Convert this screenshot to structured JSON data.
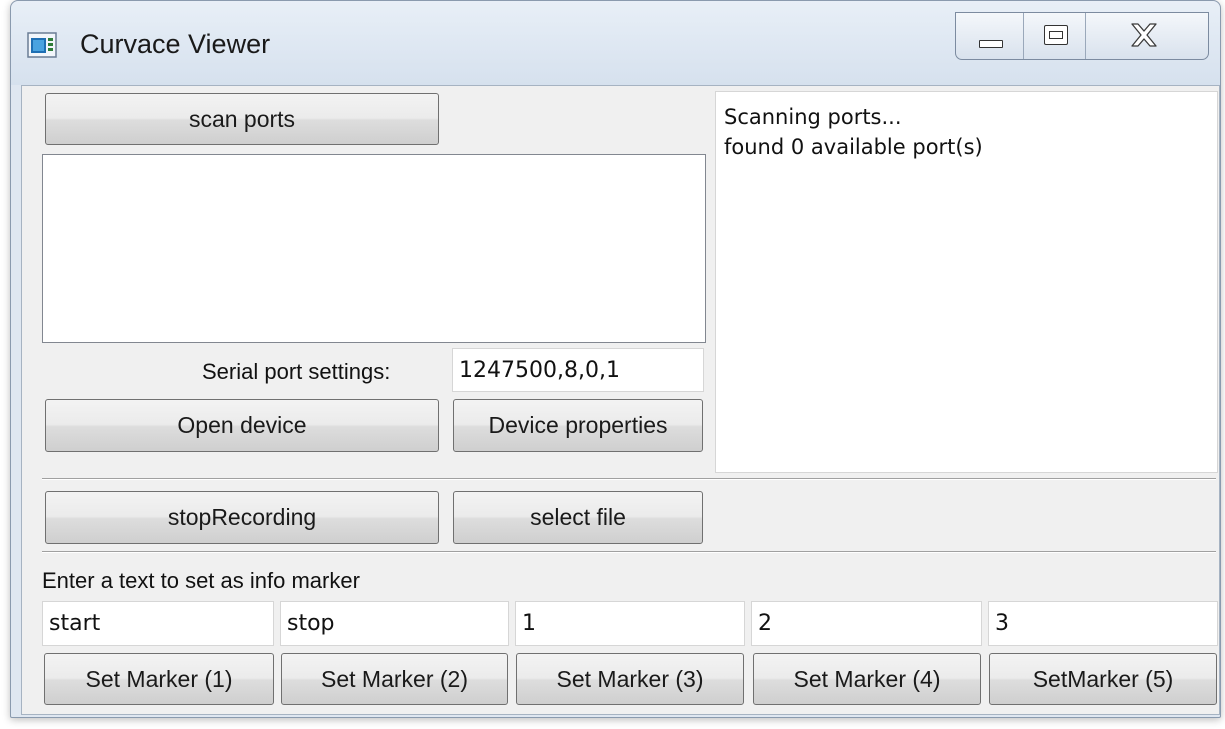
{
  "window": {
    "title": "Curvace Viewer"
  },
  "top": {
    "scan_label": "scan ports"
  },
  "log": {
    "lines": [
      "Scanning ports...",
      "found 0 available port(s)"
    ]
  },
  "serial": {
    "label": "Serial port settings:",
    "value": "1247500,8,0,1"
  },
  "device": {
    "open_label": "Open device",
    "properties_label": "Device properties"
  },
  "recording": {
    "stop_label": "stopRecording",
    "select_file_label": "select file"
  },
  "markers": {
    "prompt": "Enter a text to set as info marker",
    "fields": [
      "start",
      "stop",
      "1",
      "2",
      "3"
    ],
    "buttons": [
      "Set Marker (1)",
      "Set Marker (2)",
      "Set Marker (3)",
      "Set Marker (4)",
      "SetMarker (5)"
    ]
  },
  "icons": {
    "app": "app-window-icon",
    "minimize": "minimize-icon",
    "maximize": "maximize-icon",
    "close": "close-icon"
  }
}
